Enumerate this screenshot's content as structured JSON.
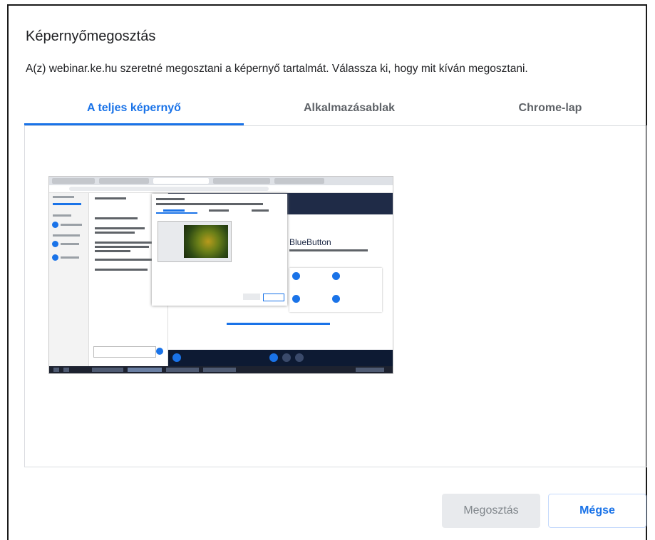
{
  "dialog": {
    "title": "Képernyőmegosztás",
    "subtitle": "A(z) webinar.ke.hu szeretné megosztani a képernyő tartalmát. Válassza ki, hogy mit kíván megosztani."
  },
  "tabs": [
    {
      "label": "A teljes képernyő",
      "active": true
    },
    {
      "label": "Alkalmazásablak",
      "active": false
    },
    {
      "label": "Chrome-lap",
      "active": false
    }
  ],
  "preview": {
    "brand_text": "BlueButton"
  },
  "buttons": {
    "share_label": "Megosztás",
    "share_disabled": true,
    "cancel_label": "Mégse"
  },
  "colors": {
    "accent": "#1a73e8",
    "disabled_bg": "#e8eaed",
    "disabled_text": "#80868b",
    "text": "#202124",
    "tab_text": "#5f6368"
  }
}
